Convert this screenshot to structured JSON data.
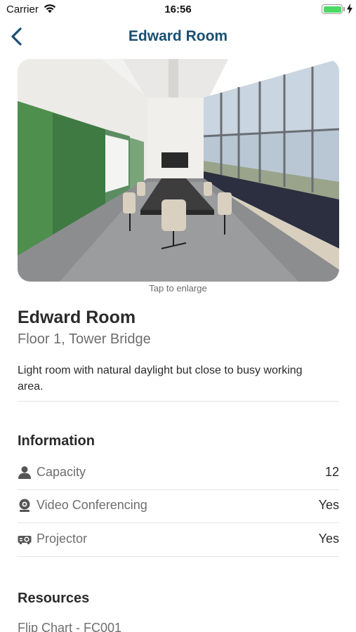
{
  "status_bar": {
    "carrier": "Carrier",
    "time": "16:56",
    "battery_color": "#4cd964"
  },
  "nav": {
    "title": "Edward Room",
    "back_icon": "chevron-left-icon",
    "accent_color": "#1a4f72"
  },
  "hero": {
    "caption": "Tap to enlarge"
  },
  "room": {
    "name": "Edward Room",
    "location": "Floor 1, Tower Bridge",
    "description": "Light room with natural daylight but close to busy working area."
  },
  "information": {
    "title": "Information",
    "rows": [
      {
        "icon": "person-icon",
        "label": "Capacity",
        "value": "12"
      },
      {
        "icon": "webcam-icon",
        "label": "Video Conferencing",
        "value": "Yes"
      },
      {
        "icon": "projector-icon",
        "label": "Projector",
        "value": "Yes"
      }
    ]
  },
  "resources": {
    "title": "Resources",
    "items": [
      "Flip Chart - FC001"
    ]
  }
}
